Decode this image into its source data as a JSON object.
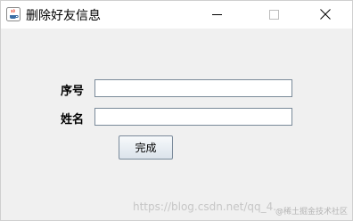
{
  "window": {
    "title": "删除好友信息",
    "icon": "java-cup-icon",
    "controls": {
      "minimize_icon": "minimize-icon",
      "maximize_icon": "maximize-icon",
      "close_icon": "close-icon"
    }
  },
  "form": {
    "id_label": "序号",
    "id_value": "",
    "name_label": "姓名",
    "name_value": "",
    "submit_label": "完成"
  },
  "watermark": {
    "text": "https://blog.csdn.net/qq_4...",
    "tag": "@稀土掘金技术社区"
  },
  "colors": {
    "window_bg": "#f0f0f0",
    "titlebar_bg": "#ffffff",
    "field_border": "#7a8a99"
  }
}
